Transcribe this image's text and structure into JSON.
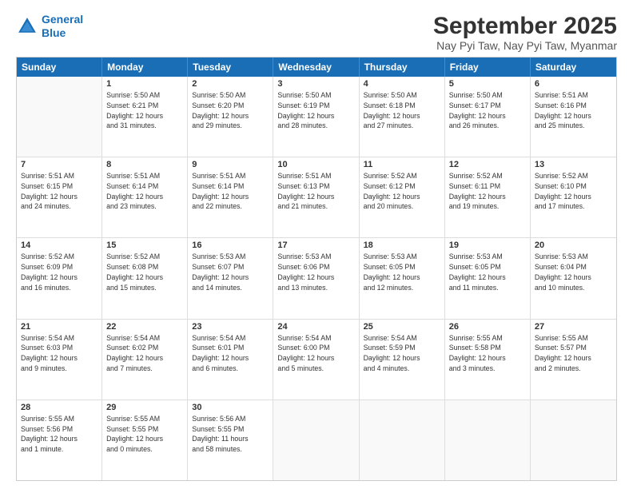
{
  "logo": {
    "line1": "General",
    "line2": "Blue"
  },
  "title": "September 2025",
  "location": "Nay Pyi Taw, Nay Pyi Taw, Myanmar",
  "days_header": [
    "Sunday",
    "Monday",
    "Tuesday",
    "Wednesday",
    "Thursday",
    "Friday",
    "Saturday"
  ],
  "weeks": [
    [
      {
        "day": "",
        "info": ""
      },
      {
        "day": "1",
        "info": "Sunrise: 5:50 AM\nSunset: 6:21 PM\nDaylight: 12 hours\nand 31 minutes."
      },
      {
        "day": "2",
        "info": "Sunrise: 5:50 AM\nSunset: 6:20 PM\nDaylight: 12 hours\nand 29 minutes."
      },
      {
        "day": "3",
        "info": "Sunrise: 5:50 AM\nSunset: 6:19 PM\nDaylight: 12 hours\nand 28 minutes."
      },
      {
        "day": "4",
        "info": "Sunrise: 5:50 AM\nSunset: 6:18 PM\nDaylight: 12 hours\nand 27 minutes."
      },
      {
        "day": "5",
        "info": "Sunrise: 5:50 AM\nSunset: 6:17 PM\nDaylight: 12 hours\nand 26 minutes."
      },
      {
        "day": "6",
        "info": "Sunrise: 5:51 AM\nSunset: 6:16 PM\nDaylight: 12 hours\nand 25 minutes."
      }
    ],
    [
      {
        "day": "7",
        "info": "Sunrise: 5:51 AM\nSunset: 6:15 PM\nDaylight: 12 hours\nand 24 minutes."
      },
      {
        "day": "8",
        "info": "Sunrise: 5:51 AM\nSunset: 6:14 PM\nDaylight: 12 hours\nand 23 minutes."
      },
      {
        "day": "9",
        "info": "Sunrise: 5:51 AM\nSunset: 6:14 PM\nDaylight: 12 hours\nand 22 minutes."
      },
      {
        "day": "10",
        "info": "Sunrise: 5:51 AM\nSunset: 6:13 PM\nDaylight: 12 hours\nand 21 minutes."
      },
      {
        "day": "11",
        "info": "Sunrise: 5:52 AM\nSunset: 6:12 PM\nDaylight: 12 hours\nand 20 minutes."
      },
      {
        "day": "12",
        "info": "Sunrise: 5:52 AM\nSunset: 6:11 PM\nDaylight: 12 hours\nand 19 minutes."
      },
      {
        "day": "13",
        "info": "Sunrise: 5:52 AM\nSunset: 6:10 PM\nDaylight: 12 hours\nand 17 minutes."
      }
    ],
    [
      {
        "day": "14",
        "info": "Sunrise: 5:52 AM\nSunset: 6:09 PM\nDaylight: 12 hours\nand 16 minutes."
      },
      {
        "day": "15",
        "info": "Sunrise: 5:52 AM\nSunset: 6:08 PM\nDaylight: 12 hours\nand 15 minutes."
      },
      {
        "day": "16",
        "info": "Sunrise: 5:53 AM\nSunset: 6:07 PM\nDaylight: 12 hours\nand 14 minutes."
      },
      {
        "day": "17",
        "info": "Sunrise: 5:53 AM\nSunset: 6:06 PM\nDaylight: 12 hours\nand 13 minutes."
      },
      {
        "day": "18",
        "info": "Sunrise: 5:53 AM\nSunset: 6:05 PM\nDaylight: 12 hours\nand 12 minutes."
      },
      {
        "day": "19",
        "info": "Sunrise: 5:53 AM\nSunset: 6:05 PM\nDaylight: 12 hours\nand 11 minutes."
      },
      {
        "day": "20",
        "info": "Sunrise: 5:53 AM\nSunset: 6:04 PM\nDaylight: 12 hours\nand 10 minutes."
      }
    ],
    [
      {
        "day": "21",
        "info": "Sunrise: 5:54 AM\nSunset: 6:03 PM\nDaylight: 12 hours\nand 9 minutes."
      },
      {
        "day": "22",
        "info": "Sunrise: 5:54 AM\nSunset: 6:02 PM\nDaylight: 12 hours\nand 7 minutes."
      },
      {
        "day": "23",
        "info": "Sunrise: 5:54 AM\nSunset: 6:01 PM\nDaylight: 12 hours\nand 6 minutes."
      },
      {
        "day": "24",
        "info": "Sunrise: 5:54 AM\nSunset: 6:00 PM\nDaylight: 12 hours\nand 5 minutes."
      },
      {
        "day": "25",
        "info": "Sunrise: 5:54 AM\nSunset: 5:59 PM\nDaylight: 12 hours\nand 4 minutes."
      },
      {
        "day": "26",
        "info": "Sunrise: 5:55 AM\nSunset: 5:58 PM\nDaylight: 12 hours\nand 3 minutes."
      },
      {
        "day": "27",
        "info": "Sunrise: 5:55 AM\nSunset: 5:57 PM\nDaylight: 12 hours\nand 2 minutes."
      }
    ],
    [
      {
        "day": "28",
        "info": "Sunrise: 5:55 AM\nSunset: 5:56 PM\nDaylight: 12 hours\nand 1 minute."
      },
      {
        "day": "29",
        "info": "Sunrise: 5:55 AM\nSunset: 5:55 PM\nDaylight: 12 hours\nand 0 minutes."
      },
      {
        "day": "30",
        "info": "Sunrise: 5:56 AM\nSunset: 5:55 PM\nDaylight: 11 hours\nand 58 minutes."
      },
      {
        "day": "",
        "info": ""
      },
      {
        "day": "",
        "info": ""
      },
      {
        "day": "",
        "info": ""
      },
      {
        "day": "",
        "info": ""
      }
    ]
  ]
}
